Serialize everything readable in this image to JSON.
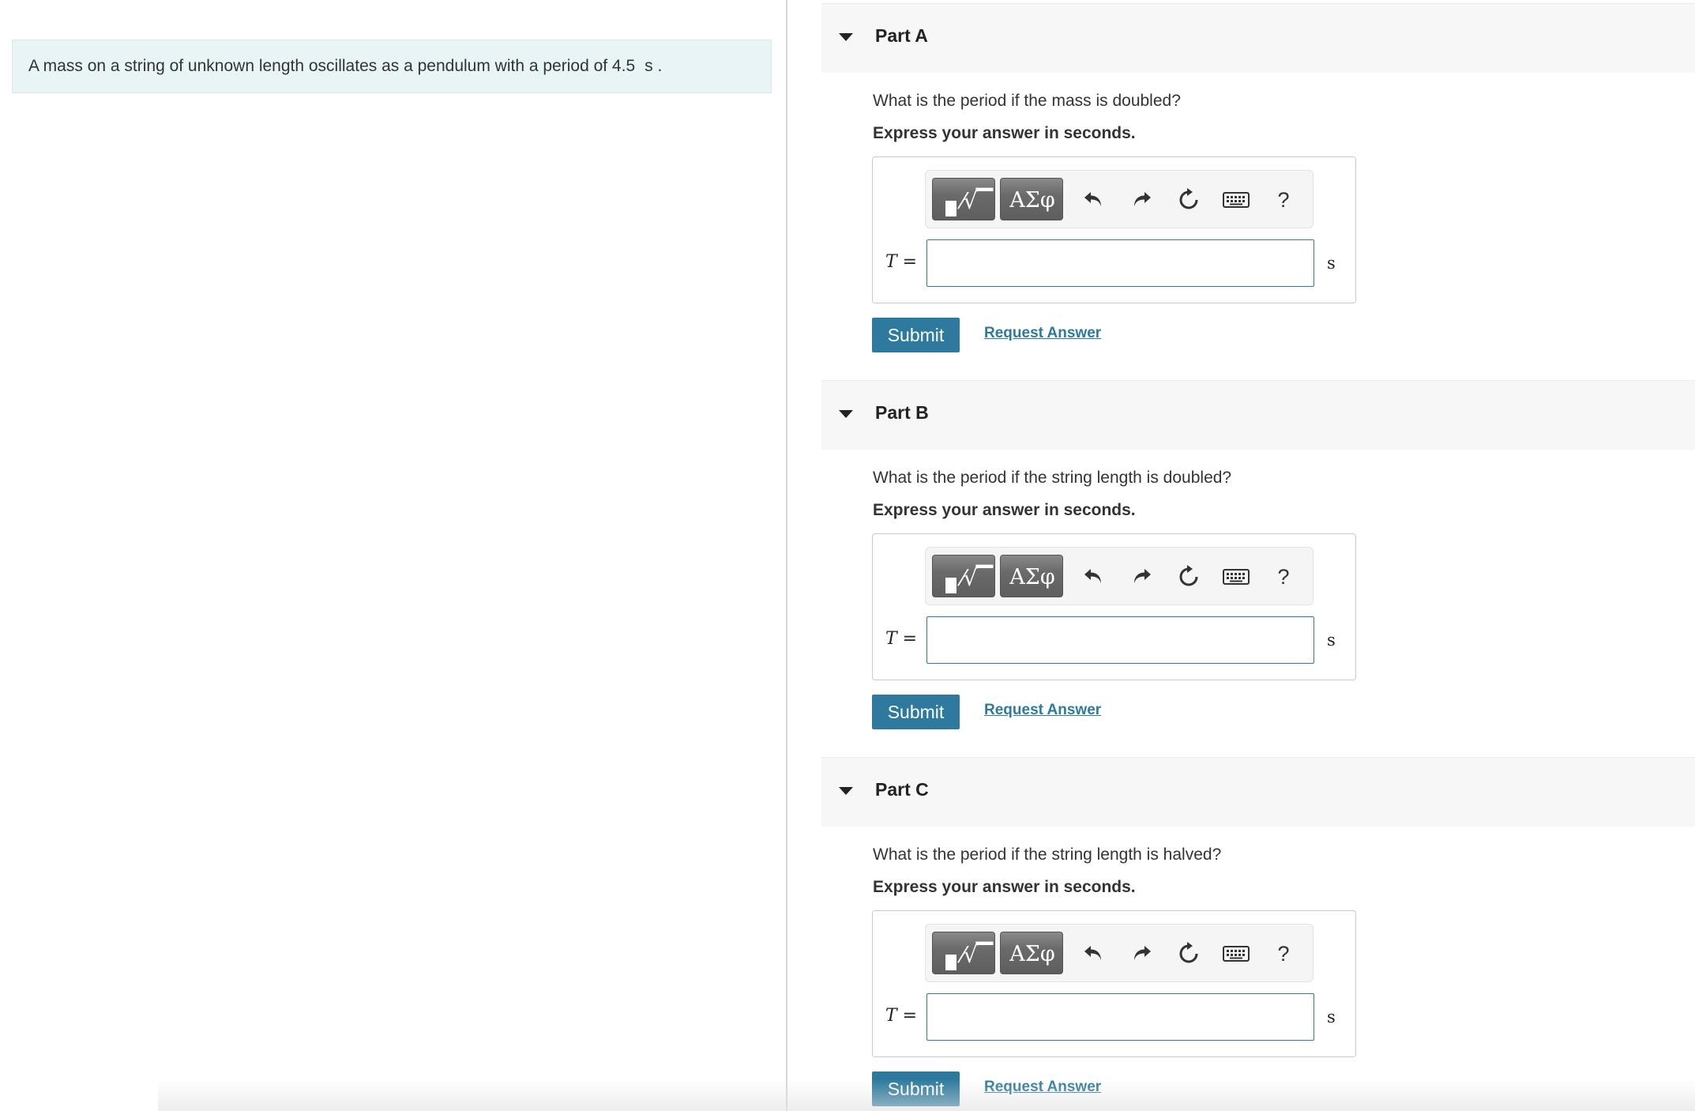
{
  "problem": {
    "text": "A mass on a string of unknown length oscillates as a pendulum with a period of 4.5",
    "unit": "s ."
  },
  "toolbar": {
    "templates_icon": "templates-icon",
    "greek_label": "ΑΣφ",
    "help_label": "?"
  },
  "parts": [
    {
      "title": "Part A",
      "question": "What is the period if the mass is doubled?",
      "instruction": "Express your answer in seconds.",
      "variable": "T",
      "equals": " =",
      "answer_value": "",
      "unit": "s",
      "submit_label": "Submit",
      "request_label": "Request Answer"
    },
    {
      "title": "Part B",
      "question": "What is the period if the string length is doubled?",
      "instruction": "Express your answer in seconds.",
      "variable": "T",
      "equals": " =",
      "answer_value": "",
      "unit": "s",
      "submit_label": "Submit",
      "request_label": "Request Answer"
    },
    {
      "title": "Part C",
      "question": "What is the period if the string length is halved?",
      "instruction": "Express your answer in seconds.",
      "variable": "T",
      "equals": " =",
      "answer_value": "",
      "unit": "s",
      "submit_label": "Submit",
      "request_label": "Request Answer"
    }
  ]
}
